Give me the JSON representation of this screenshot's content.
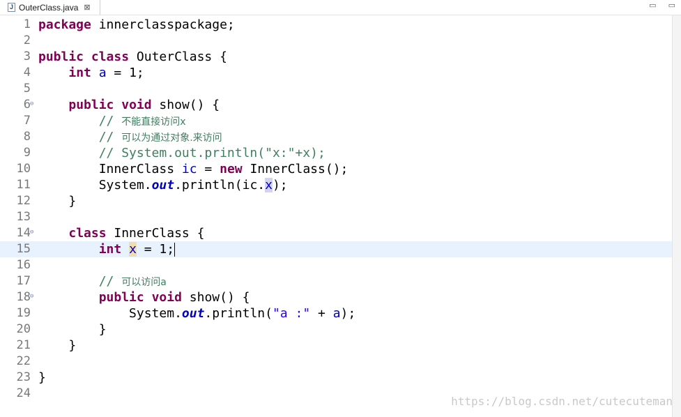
{
  "tab": {
    "title": "OuterClass.java",
    "close_glyph": "⊠"
  },
  "window_buttons": [
    "▭",
    "▭"
  ],
  "lines": [
    {
      "n": "1",
      "tokens": [
        {
          "t": "package",
          "c": "kw"
        },
        {
          "t": " innerclasspackage;",
          "c": ""
        }
      ]
    },
    {
      "n": "2",
      "tokens": []
    },
    {
      "n": "3",
      "tokens": [
        {
          "t": "public",
          "c": "kw"
        },
        {
          "t": " ",
          "c": ""
        },
        {
          "t": "class",
          "c": "kw"
        },
        {
          "t": " OuterClass {",
          "c": ""
        }
      ]
    },
    {
      "n": "4",
      "tokens": [
        {
          "t": "    ",
          "c": ""
        },
        {
          "t": "int",
          "c": "kw"
        },
        {
          "t": " ",
          "c": ""
        },
        {
          "t": "a",
          "c": "var"
        },
        {
          "t": " = 1;",
          "c": ""
        }
      ]
    },
    {
      "n": "5",
      "tokens": []
    },
    {
      "n": "6",
      "fold": true,
      "tokens": [
        {
          "t": "    ",
          "c": ""
        },
        {
          "t": "public",
          "c": "kw"
        },
        {
          "t": " ",
          "c": ""
        },
        {
          "t": "void",
          "c": "kw"
        },
        {
          "t": " show() {",
          "c": ""
        }
      ]
    },
    {
      "n": "7",
      "tokens": [
        {
          "t": "        // ",
          "c": "cm"
        },
        {
          "t": "不能直接访问x",
          "c": "cm cjk"
        }
      ]
    },
    {
      "n": "8",
      "tokens": [
        {
          "t": "        // ",
          "c": "cm"
        },
        {
          "t": "可以为通过对象.来访问",
          "c": "cm cjk"
        }
      ]
    },
    {
      "n": "9",
      "tokens": [
        {
          "t": "        // System.out.println(\"x:\"+x);",
          "c": "cm"
        }
      ]
    },
    {
      "n": "10",
      "tokens": [
        {
          "t": "        InnerClass ",
          "c": ""
        },
        {
          "t": "ic",
          "c": "var"
        },
        {
          "t": " = ",
          "c": ""
        },
        {
          "t": "new",
          "c": "kw"
        },
        {
          "t": " InnerClass();",
          "c": ""
        }
      ]
    },
    {
      "n": "11",
      "tokens": [
        {
          "t": "        System.",
          "c": ""
        },
        {
          "t": "out",
          "c": "stat"
        },
        {
          "t": ".println(ic.",
          "c": ""
        },
        {
          "t": "x",
          "c": "var hl-read"
        },
        {
          "t": ");",
          "c": ""
        }
      ]
    },
    {
      "n": "12",
      "tokens": [
        {
          "t": "    }",
          "c": ""
        }
      ]
    },
    {
      "n": "13",
      "tokens": []
    },
    {
      "n": "14",
      "fold": true,
      "tokens": [
        {
          "t": "    ",
          "c": ""
        },
        {
          "t": "class",
          "c": "kw"
        },
        {
          "t": " InnerClass {",
          "c": ""
        }
      ]
    },
    {
      "n": "15",
      "current": true,
      "tokens": [
        {
          "t": "        ",
          "c": ""
        },
        {
          "t": "int",
          "c": "kw"
        },
        {
          "t": " ",
          "c": ""
        },
        {
          "t": "x",
          "c": "var hl-write"
        },
        {
          "t": " = 1;",
          "c": ""
        },
        {
          "t": "",
          "c": "caret"
        }
      ]
    },
    {
      "n": "16",
      "tokens": []
    },
    {
      "n": "17",
      "tokens": [
        {
          "t": "        // ",
          "c": "cm"
        },
        {
          "t": "可以访问a",
          "c": "cm cjk"
        }
      ]
    },
    {
      "n": "18",
      "fold": true,
      "tokens": [
        {
          "t": "        ",
          "c": ""
        },
        {
          "t": "public",
          "c": "kw"
        },
        {
          "t": " ",
          "c": ""
        },
        {
          "t": "void",
          "c": "kw"
        },
        {
          "t": " show() {",
          "c": ""
        }
      ]
    },
    {
      "n": "19",
      "tokens": [
        {
          "t": "            System.",
          "c": ""
        },
        {
          "t": "out",
          "c": "stat"
        },
        {
          "t": ".println(",
          "c": ""
        },
        {
          "t": "\"a :\"",
          "c": "str"
        },
        {
          "t": " + ",
          "c": ""
        },
        {
          "t": "a",
          "c": "var"
        },
        {
          "t": ");",
          "c": ""
        }
      ]
    },
    {
      "n": "20",
      "tokens": [
        {
          "t": "        }",
          "c": ""
        }
      ]
    },
    {
      "n": "21",
      "tokens": [
        {
          "t": "    }",
          "c": ""
        }
      ]
    },
    {
      "n": "22",
      "tokens": []
    },
    {
      "n": "23",
      "tokens": [
        {
          "t": "}",
          "c": ""
        }
      ]
    },
    {
      "n": "24",
      "tokens": []
    }
  ],
  "watermark": "https://blog.csdn.net/cutecuteman"
}
